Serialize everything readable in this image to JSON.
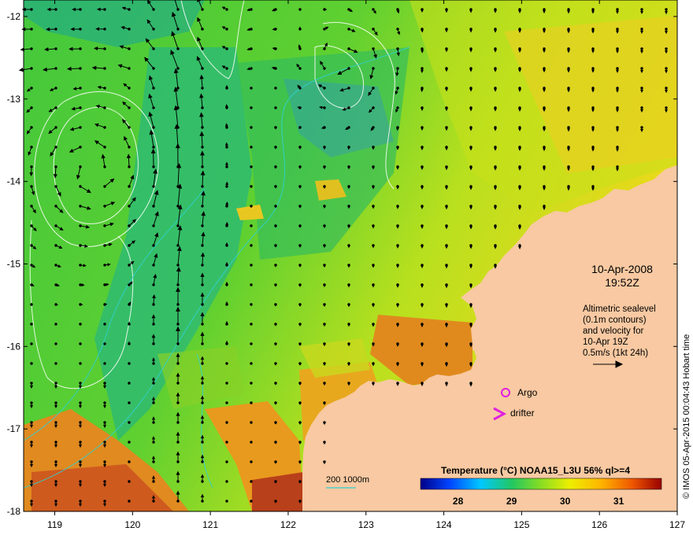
{
  "map": {
    "lon_range": [
      118.6,
      127
    ],
    "lat_range": [
      -18,
      -11.8
    ],
    "lon_ticks": [
      "119",
      "120",
      "121",
      "122",
      "123",
      "124",
      "125",
      "126",
      "127"
    ],
    "lat_ticks": [
      "-12",
      "-13",
      "-14",
      "-15",
      "-16",
      "-17",
      "-18"
    ],
    "land_color": "#f8c9a2",
    "ocean_colors": {
      "dominant": "#3cc83c",
      "warm": "#e07a18",
      "cool": "#1e8be0"
    }
  },
  "annotation": {
    "date": "10-Apr-2008",
    "time": "19:52Z",
    "lines": [
      "Altimetric sealevel",
      "(0.1m contours)",
      "and velocity for",
      "10-Apr 19Z",
      "0.5m/s (1kt 24h)"
    ]
  },
  "colorbar": {
    "title": "Temperature (°C) NOAA15_L3U 56% ql>=4",
    "ticks": [
      "28",
      "29",
      "30",
      "31"
    ],
    "tick_values": [
      28,
      29,
      30,
      31
    ],
    "range": [
      27.3,
      31.8
    ]
  },
  "legend": {
    "depth_label": "200  1000m",
    "argo_label": "Argo",
    "drifter_label": "drifter",
    "argo_color": "#e020e0",
    "drifter_color": "#e020e0"
  },
  "credit": "© IMOS 05-Apr-2015 00:04:43 Hobart time"
}
